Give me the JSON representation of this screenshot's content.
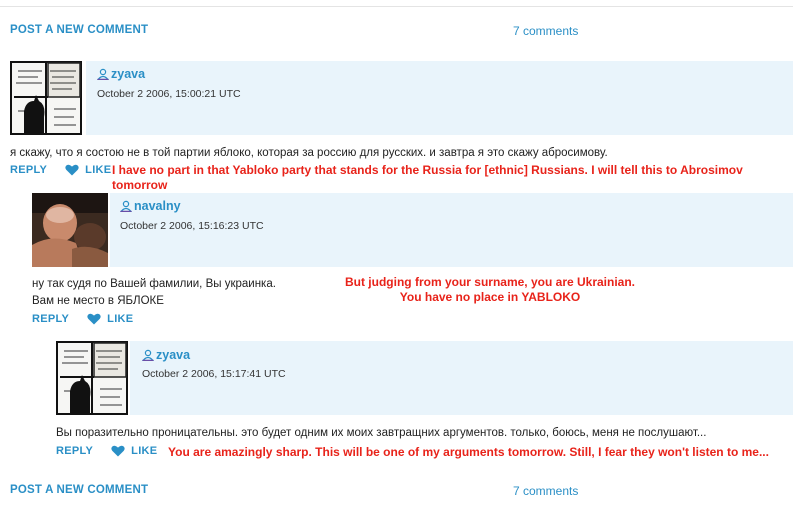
{
  "top_bar": {
    "post_label": "POST A NEW COMMENT",
    "count_label": "7 comments"
  },
  "bottom_bar": {
    "post_label": "POST A NEW COMMENT",
    "count_label": "7 comments"
  },
  "comments": [
    {
      "username": "zyava",
      "date": "October 2 2006, 15:00:21 UTC",
      "text": "я скажу, что я состою не в той партии яблоко, которая за россию для русских. и завтра я это скажу абросимову.",
      "reply_label": "REPLY",
      "like_label": "LIKE",
      "translation": "I have no part in that Yabloko party that stands for the Russia for [ethnic] Russians. I will tell this to Abrosimov tomorrow"
    },
    {
      "username": "navalny",
      "date": "October 2 2006, 15:16:23 UTC",
      "text_line1": "ну так судя по Вашей фамилии, Вы украинка.",
      "text_line2": "Вам не место в ЯБЛОКЕ",
      "reply_label": "REPLY",
      "like_label": "LIKE",
      "translation_line1": "But judging from your surname, you are Ukrainian.",
      "translation_line2": "You have no place in YABLOKO"
    },
    {
      "username": "zyava",
      "date": "October 2 2006, 15:17:41 UTC",
      "text": "Вы поразительно проницательны. это будет одним их моих завтращних аргументов. только, боюсь, меня не послушают...",
      "reply_label": "REPLY",
      "like_label": "LIKE",
      "translation": "You are amazingly sharp. This will be one of my arguments tomorrow. Still, I fear they won't listen to me..."
    }
  ],
  "colors": {
    "link": "#2a8fc6",
    "header_bg": "#e9f4fb",
    "annotation": "#e8231a"
  },
  "icons": {
    "user": "user-icon",
    "like": "heart-icon"
  }
}
